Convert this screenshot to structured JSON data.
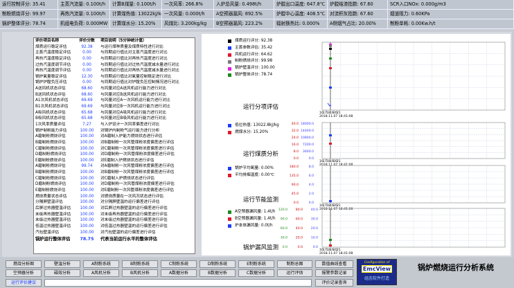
{
  "status": [
    [
      "运行控制评分: 35.41",
      "主蒸汽流量: 0.100t/h",
      "计算B煤量: 0.100t/h",
      "一次风率: 266.8%",
      "入炉总风量: 0.498t/h",
      "炉膛出口温度: 647.8℃",
      "炉膛结渣指数: 67.60",
      "SCR入口NOx: 0.000g/m3"
    ],
    [
      "制粉燃烧评分: 99.97",
      "再热汽流量: 0.100t/h",
      "计算煤热值: 13022kJ/kg",
      "一次风量: 0.000t/h",
      "A空预器漏风: 892.5%",
      "炉膛中心温度: 408.5℃",
      "对流积灰指数: 67.60",
      "烟道阻力: 0.60KPa"
    ],
    [
      "锅炉整体评分: 78.74",
      "机组电负荷: 0.000MW",
      "计算煤水分: 15.20%",
      "风煤比: 3.200kg/kg",
      "B空预器漏风: 223.2%",
      "辐射换热比: 0.000%",
      "A侧烟气占比: 20.00%",
      "制粉单耗: 0.00Kw.h/t"
    ]
  ],
  "table": {
    "header": [
      "评价项目名称",
      "评价分数",
      "项目说明（5分钟统计值）"
    ],
    "rows": [
      [
        "煤质运行稳定评估",
        "92.38",
        "与运行煤种质量及煤质特性进行对比"
      ],
      [
        "主蒸汽温度稳定评估",
        "0.00",
        "与同期运行值比对主蒸汽温度进行对比"
      ],
      [
        "再热汽温度稳定评估",
        "0.00",
        "与同期运行值比对再热汽温度进行对比"
      ],
      [
        "过热汽温度调节评估",
        "0.00",
        "与同期运行值比对过热汽温度减水量进行对比"
      ],
      [
        "再热汽温度调节评估",
        "0.00",
        "与同期运行值比对再热汽温度减水量进行对比"
      ],
      [
        "锅炉氧量稳定评估",
        "12.30",
        "与同期运行值比对氧量控制稳定进行对比"
      ],
      [
        "锅炉炉膛负压评估",
        "0.00",
        "与同期运行值比对炉膛负压控制情况进行对比"
      ],
      [
        "A送风机状态评估",
        "68.60",
        "与风量对应A送风机运行能力进行对比"
      ],
      [
        "B送风机状态评估",
        "68.60",
        "与风量对应B送风机运行能力进行对比"
      ],
      [
        "A1次风机状态评估",
        "69.69",
        "与风量对应A一次风机运行能力进行对比"
      ],
      [
        "B1次风机状态评估",
        "69.69",
        "与风量对应B一次风机运行能力进行对比"
      ],
      [
        "A吸风机状态评估",
        "65.68",
        "与风量对应A吸风机运行能力进行对比"
      ],
      [
        "B吸风机状态评估",
        "65.68",
        "与风量对应B吸风机运行能力进行对比"
      ],
      [
        "1次风率质量评估",
        "7.27",
        "与入炉设计一次风率偏差进行对比"
      ],
      [
        "锅炉制粉能力评估",
        "100.00",
        "对锅炉内制粉气运行能力进行分析"
      ],
      [
        "A磨制粉燃烧评估",
        "100.00",
        "对A磨制入炉能力燃烧状态进行评估"
      ],
      [
        "B磨制粉燃烧评估",
        "100.00",
        "对B磨制粉一次风管煤粉浓度偏差进行评估"
      ],
      [
        "C磨制粉燃烧评估",
        "100.00",
        "对C磨制粉一次风管煤粉浓度偏差进行评估"
      ],
      [
        "D磨制粉燃烧评估",
        "100.00",
        "对D磨制粉一次风管煤粉浓度偏差进行评估"
      ],
      [
        "E磨制粉燃烧评估",
        "100.00",
        "对E磨制入炉燃烧状态进行评估"
      ],
      [
        "A磨制粉燃烧评估",
        "99.74",
        "对A磨制粉一次风管煤粉浓度偏差进行评估"
      ],
      [
        "B磨制粉燃烧评估",
        "100.00",
        "对B磨制粉一次风管煤粉浓度偏差进行评估"
      ],
      [
        "C磨制粉燃烧评估",
        "100.00",
        "对C磨制入炉燃烧状态进行评估"
      ],
      [
        "D磨制粉燃烧评估",
        "100.00",
        "对D磨制粉一次风管煤粉浓度偏差进行评估"
      ],
      [
        "E磨制粉燃烧评估",
        "100.00",
        "对E磨制粉一次风管煤粉浓度偏差进行评估"
      ],
      [
        "燃烧质量状态评估",
        "100.00",
        "对燃烧质量在一次风况状态进行评估"
      ],
      [
        "分隔屏壁温评估",
        "100.00",
        "对分隔屏壁温的运行偏差进行评估"
      ],
      [
        "后屏过热器壁温评估",
        "100.00",
        "对后屏过热器壁温的运行偏差进行评估"
      ],
      [
        "末级再热器壁温评估",
        "100.00",
        "对末级再热器壁温的运行偏差进行评估"
      ],
      [
        "末级过热器壁温评估",
        "100.00",
        "对末级过热器壁温的运行偏差进行评估"
      ],
      [
        "低温过热器壁温评估",
        "100.00",
        "对低温过热器壁温的运行偏差进行评估"
      ],
      [
        "汽包壁温评估",
        "100.00",
        "对汽包壁温的运行偏差进行评估"
      ]
    ],
    "footer": [
      "锅炉运行整体评估",
      "78.75",
      "代表当前运行水平的整体评估"
    ]
  },
  "panels": {
    "p1": {
      "title": "运行分项评估",
      "legend": [
        {
          "label": "煤质运行评分: 92.38",
          "color": "#000000"
        },
        {
          "label": "主蒸参数评估: 35.42",
          "color": "#1a3cff"
        },
        {
          "label": "风机运行评分: 64.62",
          "color": "#e0192c"
        },
        {
          "label": "制粉燃烧评分: 99.98",
          "color": "#7a7a7a"
        },
        {
          "label": "锅炉壁温评分: 100.00",
          "color": "#e21fe0"
        },
        {
          "label": "锅炉整体评分: 78.74",
          "color": "#1c8a1c"
        }
      ]
    },
    "p2": {
      "title": "运行煤质分析",
      "legend": [
        {
          "label": "低位热值: 13022.8kJ/kg",
          "color": "#1a3cff"
        },
        {
          "label": "燃煤水分: 15.20%",
          "color": "#e0192c"
        }
      ],
      "axis_red": [
        "40.0",
        "32.0",
        "24.0",
        "16.0",
        "8.0",
        "0.0"
      ],
      "axis_blue": [
        "18000.0",
        "14400.0",
        "10800.0",
        "7200.0",
        "3600.0",
        "0.0"
      ]
    },
    "p3": {
      "title": "运行节能监测",
      "legend": [
        {
          "label": "锅炉平均氧量: 0.00%",
          "color": "#1a3cff"
        },
        {
          "label": "平均排烟温度: 0.00℃",
          "color": "#e0192c"
        }
      ],
      "axis_red": [
        "180.0",
        "135.0",
        "90.0",
        "45.0",
        "0.0"
      ],
      "axis_blue": [
        "8.0",
        "6.0",
        "4.0",
        "2.0",
        "0.0"
      ]
    },
    "p4": {
      "title": "锅炉漏风监测",
      "legend": [
        {
          "label": "A空预器漏风量: 1.4t/h",
          "color": "#1c8a1c"
        },
        {
          "label": "B空预器漏风量: 1.4t/h",
          "color": "#e0192c"
        },
        {
          "label": "炉本体漏风量: 0.0t/h",
          "color": "#1a3cff"
        }
      ],
      "axis_green": [
        "120.0",
        "90.0",
        "60.0",
        "30.0",
        "0.0"
      ],
      "axis_red": [
        "80.0",
        "60.0",
        "40.0",
        "20.0",
        "0.0"
      ],
      "axis_blue": [
        "40.0",
        "30.0",
        "20.0",
        "10.0",
        "0.0"
      ]
    },
    "timestamp": "2018.11.07 18:41:08",
    "ticks": [
      "16",
      "17",
      "18",
      "19",
      "20",
      "21"
    ]
  },
  "buttons": {
    "row1": [
      "燃烧分析图",
      "壁温分析",
      "A制粉系统",
      "B制粉系统",
      "C制粉系统",
      "D制粉系统",
      "E制粉系统",
      "制粉总图",
      "数值曲线查看"
    ],
    "row2": [
      "空预器分析",
      "磁效分析",
      "A风机分析",
      "B风机分析",
      "A数据分析",
      "B数据分析",
      "C数据分析",
      "运行评估",
      "报警参数记录"
    ],
    "row3_left": "运行评价建议",
    "row3_right": "评价记录查询"
  },
  "logo": {
    "top": "Configuration of",
    "brand": "EmcView",
    "cn": "组态软件打造"
  },
  "system_title": "锅炉燃烧运行分析系统"
}
